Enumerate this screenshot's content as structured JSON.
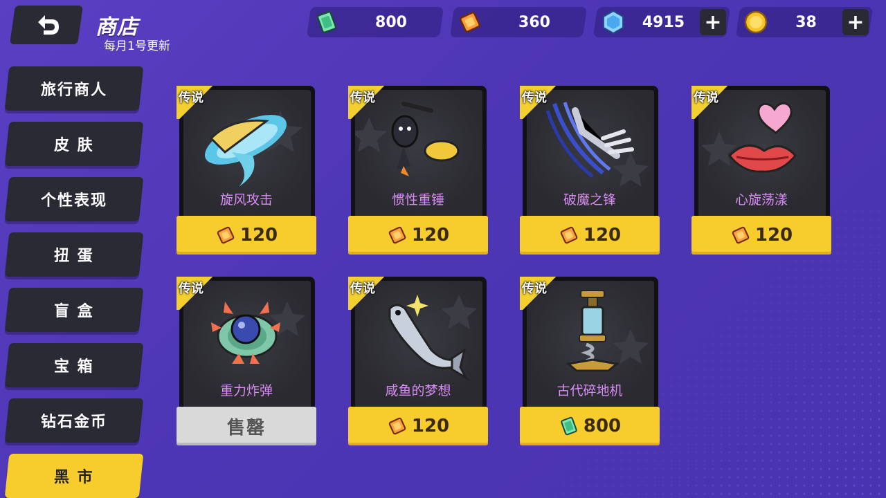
{
  "header": {
    "title": "商店",
    "subtitle": "每月1号更新"
  },
  "currencies": [
    {
      "name": "green-ticket",
      "value": "800",
      "has_plus": false
    },
    {
      "name": "orange-ticket",
      "value": "360",
      "has_plus": false
    },
    {
      "name": "diamond",
      "value": "4915",
      "has_plus": true
    },
    {
      "name": "gold-coin",
      "value": "38",
      "has_plus": true
    }
  ],
  "plus_label": "+",
  "sidebar": {
    "items": [
      {
        "label": "旅行商人",
        "active": false
      },
      {
        "label": "皮 肤",
        "active": false
      },
      {
        "label": "个性表现",
        "active": false
      },
      {
        "label": "扭 蛋",
        "active": false
      },
      {
        "label": "盲 盒",
        "active": false
      },
      {
        "label": "宝 箱",
        "active": false
      },
      {
        "label": "钻石金币",
        "active": false
      },
      {
        "label": "黑 市",
        "active": true
      }
    ]
  },
  "shop": {
    "items": [
      {
        "tag": "传说",
        "name": "旋风攻击",
        "price": "120",
        "currency": "orange-ticket",
        "sold_out": false
      },
      {
        "tag": "传说",
        "name": "惯性重锤",
        "price": "120",
        "currency": "orange-ticket",
        "sold_out": false
      },
      {
        "tag": "传说",
        "name": "破魔之锋",
        "price": "120",
        "currency": "orange-ticket",
        "sold_out": false
      },
      {
        "tag": "传说",
        "name": "心旋荡漾",
        "price": "120",
        "currency": "orange-ticket",
        "sold_out": false
      },
      {
        "tag": "传说",
        "name": "重力炸弹",
        "price": "售罄",
        "currency": "",
        "sold_out": true
      },
      {
        "tag": "传说",
        "name": "咸鱼的梦想",
        "price": "120",
        "currency": "orange-ticket",
        "sold_out": false
      },
      {
        "tag": "传说",
        "name": "古代碎地机",
        "price": "800",
        "currency": "green-ticket",
        "sold_out": false
      }
    ]
  },
  "colors": {
    "accent_yellow": "#f7cd2e",
    "panel_dark": "#2a2a35",
    "item_name": "#d88cf5",
    "background": "#5a3fc2"
  }
}
